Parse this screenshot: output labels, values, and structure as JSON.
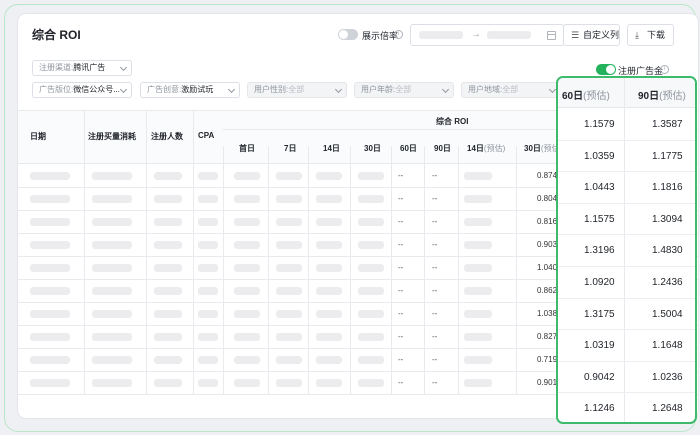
{
  "title": "综合 ROI",
  "toolbar": {
    "multiplier_label": "展示倍率",
    "date_arrow": "→",
    "custom_columns": "自定义列",
    "download": "下载"
  },
  "filters": {
    "row1": [
      {
        "key": "注册渠道:",
        "value": "腾讯广告",
        "disabled": false
      }
    ],
    "row2": [
      {
        "key": "广告版位:",
        "value": "微信公众号...",
        "disabled": false
      },
      {
        "key": "广告创意:",
        "value": "激励试玩",
        "disabled": false
      },
      {
        "key": "用户性别:",
        "value": "全部",
        "disabled": true
      },
      {
        "key": "用户年龄:",
        "value": "全部",
        "disabled": true
      },
      {
        "key": "用户地域:",
        "value": "全部",
        "disabled": true
      }
    ],
    "register_ad_gold": "注册广告金"
  },
  "table": {
    "columns": {
      "date": "日期",
      "spend": "注册买量消耗",
      "users": "注册人数",
      "cpa": "CPA",
      "group": "综合 ROI",
      "d1": "首日",
      "d7": "7日",
      "d14": "14日",
      "d30": "30日",
      "d60": "60日",
      "d90": "90日",
      "d14e": "14日",
      "d30e": "30日",
      "est": "(预估)"
    },
    "dash": "--",
    "roi30_est": [
      "0.874",
      "0.804",
      "0.816",
      "0.903",
      "1.040",
      "0.862",
      "1.038",
      "0.827",
      "0.719",
      "0.901"
    ]
  },
  "panel": {
    "h60": "60日",
    "h90": "90日",
    "est": "(预估)",
    "rows": [
      {
        "d60": "1.1579",
        "d90": "1.3587"
      },
      {
        "d60": "1.0359",
        "d90": "1.1775"
      },
      {
        "d60": "1.0443",
        "d90": "1.1816"
      },
      {
        "d60": "1.1575",
        "d90": "1.3094"
      },
      {
        "d60": "1.3196",
        "d90": "1.4830"
      },
      {
        "d60": "1.0920",
        "d90": "1.2436"
      },
      {
        "d60": "1.3175",
        "d90": "1.5004"
      },
      {
        "d60": "1.0319",
        "d90": "1.1648"
      },
      {
        "d60": "0.9042",
        "d90": "1.0236"
      },
      {
        "d60": "1.1246",
        "d90": "1.2648"
      }
    ]
  },
  "colors": {
    "accent": "#23b35c",
    "highlight_border": "#3dbb6b"
  }
}
